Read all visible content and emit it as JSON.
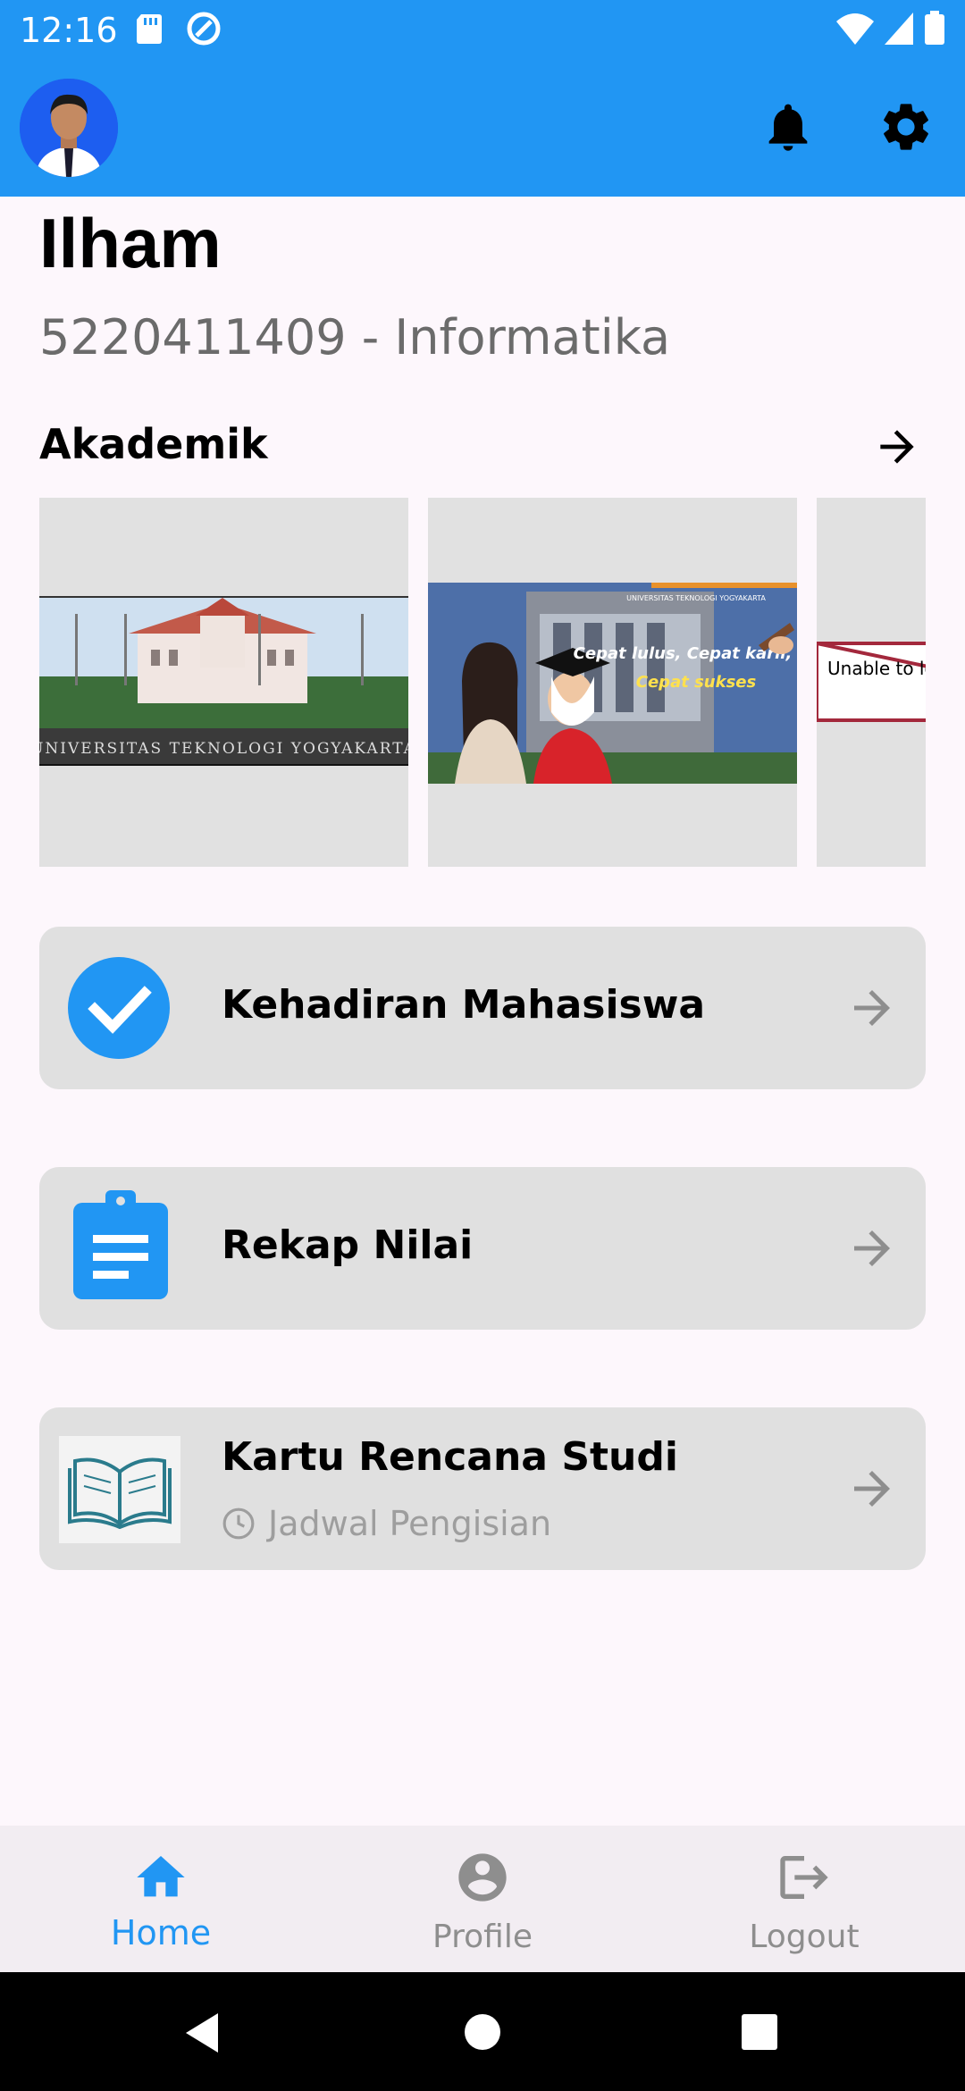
{
  "statusbar": {
    "time": "12:16"
  },
  "user": {
    "name": "Ilham",
    "id_line": "5220411409 - Informatika"
  },
  "section": {
    "title": "Akademik"
  },
  "carousel": {
    "slides": [
      {
        "caption": "UNIVERSITAS TEKNOLOGI YOGYAKARTA"
      },
      {
        "caption": "Cepat lulus, Cepat karir, Cepat sukses"
      },
      {
        "error_text": "Unable to lo... Excep"
      }
    ]
  },
  "menu": {
    "items": [
      {
        "label": "Kehadiran Mahasiswa",
        "icon": "check-circle-icon"
      },
      {
        "label": "Rekap Nilai",
        "icon": "clipboard-icon"
      },
      {
        "label": "Kartu Rencana Studi",
        "sub": "Jadwal Pengisian",
        "icon": "book-icon"
      }
    ]
  },
  "bottom_nav": {
    "items": [
      {
        "label": "Home",
        "active": true
      },
      {
        "label": "Profile",
        "active": false
      },
      {
        "label": "Logout",
        "active": false
      }
    ]
  },
  "colors": {
    "primary": "#2196f3",
    "background": "#fdf7fc",
    "card": "#e0e0e0",
    "inactive": "#8e8e8e"
  }
}
